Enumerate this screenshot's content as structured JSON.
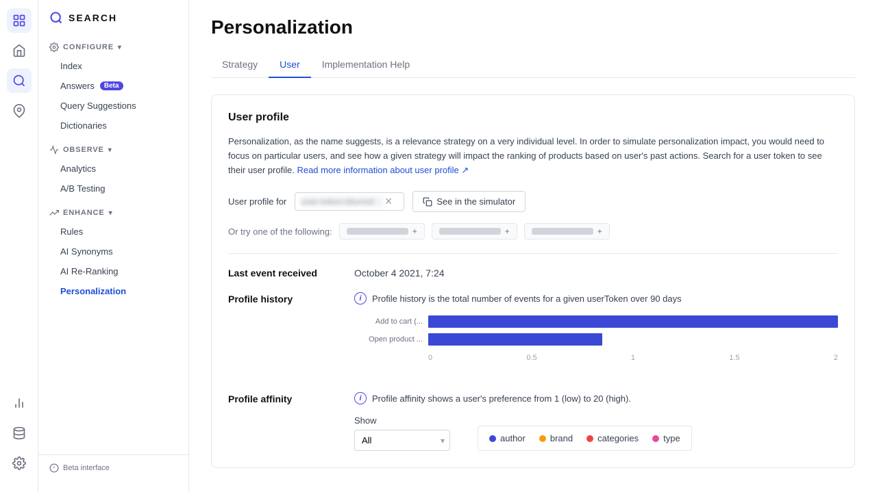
{
  "brand": {
    "icon": "🔍",
    "name": "SEARCH"
  },
  "icon_bar": {
    "icons": [
      {
        "name": "clock-icon",
        "symbol": "🕐",
        "active": true
      },
      {
        "name": "home-icon",
        "symbol": "⌂",
        "active": false
      },
      {
        "name": "search-circle-icon",
        "symbol": "🔍",
        "active": false
      },
      {
        "name": "pin-icon",
        "symbol": "📌",
        "active": false
      },
      {
        "name": "chart-icon",
        "symbol": "📊",
        "active": false
      },
      {
        "name": "database-icon",
        "symbol": "🗄",
        "active": false
      },
      {
        "name": "settings-icon",
        "symbol": "⚙",
        "active": false
      }
    ]
  },
  "sidebar": {
    "configure_label": "CONFIGURE",
    "configure_items": [
      {
        "label": "Index",
        "active": false
      },
      {
        "label": "Answers",
        "badge": "Beta",
        "active": false
      },
      {
        "label": "Query Suggestions",
        "active": false
      },
      {
        "label": "Dictionaries",
        "active": false
      }
    ],
    "observe_label": "OBSERVE",
    "observe_items": [
      {
        "label": "Analytics",
        "active": false
      },
      {
        "label": "A/B Testing",
        "active": false
      }
    ],
    "enhance_label": "ENHANCE",
    "enhance_items": [
      {
        "label": "Rules",
        "active": false
      },
      {
        "label": "AI Synonyms",
        "active": false
      },
      {
        "label": "AI Re-Ranking",
        "active": false
      },
      {
        "label": "Personalization",
        "active": true
      }
    ],
    "beta_label": "Beta interface"
  },
  "page": {
    "title": "Personalization",
    "tabs": [
      {
        "label": "Strategy",
        "active": false
      },
      {
        "label": "User",
        "active": true
      },
      {
        "label": "Implementation Help",
        "active": false
      }
    ]
  },
  "user_profile": {
    "section_title": "User profile",
    "description": "Personalization, as the name suggests, is a relevance strategy on a very individual level. In order to simulate personalization impact, you would need to focus on particular users, and see how a given strategy will impact the ranking of products based on user's past actions. Search for a user token to see their user profile.",
    "link_text": "Read more information about user profile ↗",
    "input_label": "User profile for",
    "simulator_btn": "See in the simulator",
    "or_try_label": "Or try one of the following:",
    "last_event_label": "Last event received",
    "last_event_value": "October 4 2021, 7:24",
    "profile_history_label": "Profile history",
    "profile_history_desc": "Profile history is the total number of events for a given userToken over 90 days",
    "bar_chart": {
      "bars": [
        {
          "label": "Add to cart (...",
          "value": 2,
          "max": 2,
          "pct": 100
        },
        {
          "label": "Open product ...",
          "value": 0.85,
          "max": 2,
          "pct": 42.5
        }
      ],
      "axis_labels": [
        "0",
        "0.5",
        "1",
        "1.5",
        "2"
      ]
    },
    "profile_affinity_label": "Profile affinity",
    "profile_affinity_desc": "Profile affinity shows a user's preference from 1 (low) to 20 (high).",
    "show_label": "Show",
    "show_options": [
      "All",
      "author",
      "brand",
      "categories",
      "type"
    ],
    "show_default": "All",
    "legend_items": [
      {
        "label": "author",
        "color": "#3b48d5"
      },
      {
        "label": "brand",
        "color": "#f59e0b"
      },
      {
        "label": "categories",
        "color": "#ef4444"
      },
      {
        "label": "type",
        "color": "#ec4899"
      }
    ]
  }
}
